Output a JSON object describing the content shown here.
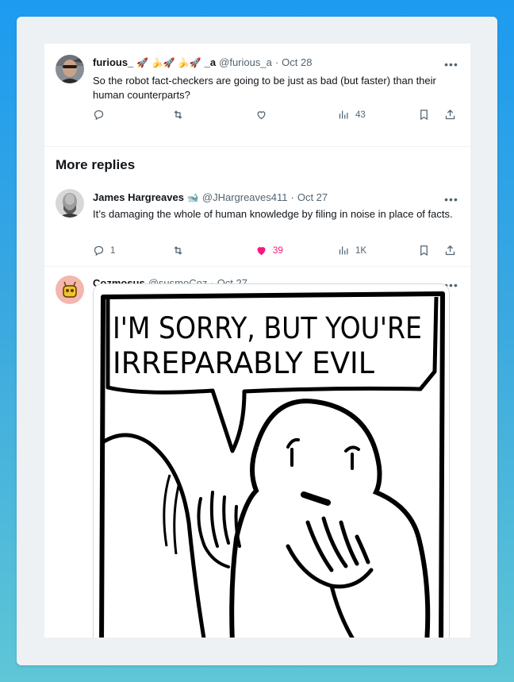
{
  "section_title": "More replies",
  "tweets": [
    {
      "name": "furious_",
      "badges": "🚀 🍌🚀 🍌🚀",
      "name_suffix": "_a",
      "handle": "@furious_a",
      "sep": "·",
      "date": "Oct 28",
      "text": "So the robot fact-checkers are going to be just as bad (but faster) than their human counterparts?",
      "stats": {
        "replies": "",
        "retweets": "",
        "likes": "",
        "views": "43"
      }
    },
    {
      "name": "James Hargreaves",
      "badges": "🐋",
      "handle": "@JHargreaves411",
      "sep": "·",
      "date": "Oct 27",
      "text": "It’s damaging the whole of human knowledge by filing in noise in place of facts.",
      "stats": {
        "replies": "1",
        "retweets": "",
        "likes": "39",
        "views": "1K"
      }
    },
    {
      "name": "Cozmosus",
      "handle": "@susmoCoz",
      "sep": "·",
      "date": "Oct 27",
      "comic_text_line1": "I'M SORRY, BUT YOU'RE",
      "comic_text_line2": "IRREPARABLY EVIL"
    }
  ],
  "colors": {
    "like_active": "#f91880",
    "muted": "#536471",
    "text": "#0f1419"
  }
}
